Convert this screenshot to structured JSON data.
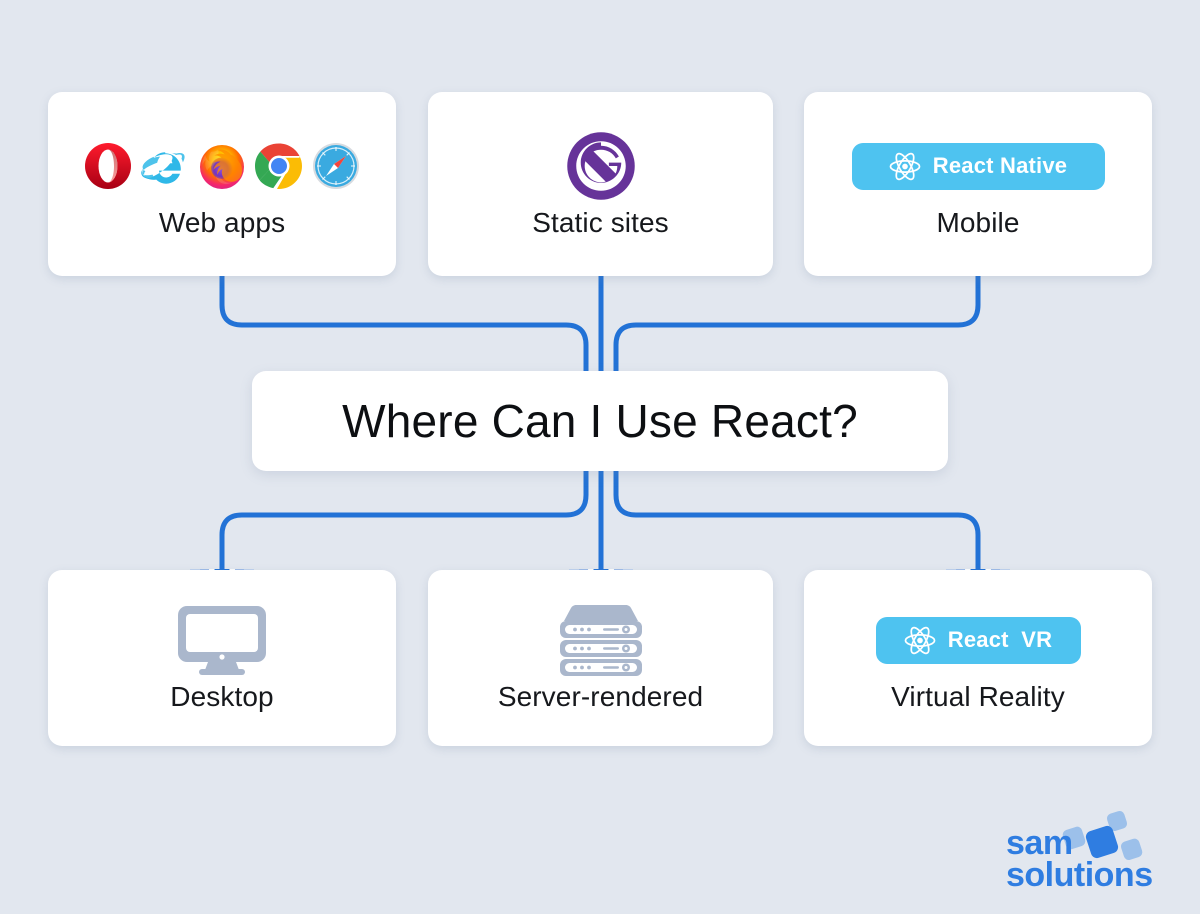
{
  "meta": {
    "title": "Where Can I Use React?",
    "background_color": "#e2e7ef",
    "accent_color": "#2272d6",
    "react_badge_color": "#4ec3f0",
    "device_icon_color": "#aab7cc",
    "gatsby_color": "#663399"
  },
  "center": {
    "label": "Where Can I Use React?"
  },
  "top_cards": [
    {
      "id": "web-apps",
      "label": "Web apps",
      "icon_kind": "browser-logos",
      "icons": [
        {
          "name": "opera-icon",
          "label": "Opera"
        },
        {
          "name": "internet-explorer-icon",
          "label": "Internet Explorer"
        },
        {
          "name": "firefox-icon",
          "label": "Firefox"
        },
        {
          "name": "chrome-icon",
          "label": "Chrome"
        },
        {
          "name": "safari-icon",
          "label": "Safari"
        }
      ]
    },
    {
      "id": "static-sites",
      "label": "Static sites",
      "icon_kind": "gatsby-logo",
      "icons": [
        {
          "name": "gatsby-icon",
          "label": "Gatsby"
        }
      ]
    },
    {
      "id": "mobile",
      "label": "Mobile",
      "icon_kind": "react-pill",
      "badge": {
        "name": "react-native-badge",
        "label": "React Native",
        "icon": "react-atom-icon"
      }
    }
  ],
  "bottom_cards": [
    {
      "id": "desktop",
      "label": "Desktop",
      "icon_kind": "monitor",
      "icons": [
        {
          "name": "monitor-icon",
          "label": "Desktop monitor"
        }
      ]
    },
    {
      "id": "server-rendered",
      "label": "Server-rendered",
      "icon_kind": "server",
      "icons": [
        {
          "name": "server-rack-icon",
          "label": "Server rack"
        }
      ]
    },
    {
      "id": "virtual-reality",
      "label": "Virtual Reality",
      "icon_kind": "react-pill",
      "badge": {
        "name": "react-vr-badge",
        "label": "React  VR",
        "icon": "react-atom-icon"
      }
    }
  ],
  "brand": {
    "line1": "sam",
    "line2": "solutions",
    "color": "#2f7de1"
  }
}
